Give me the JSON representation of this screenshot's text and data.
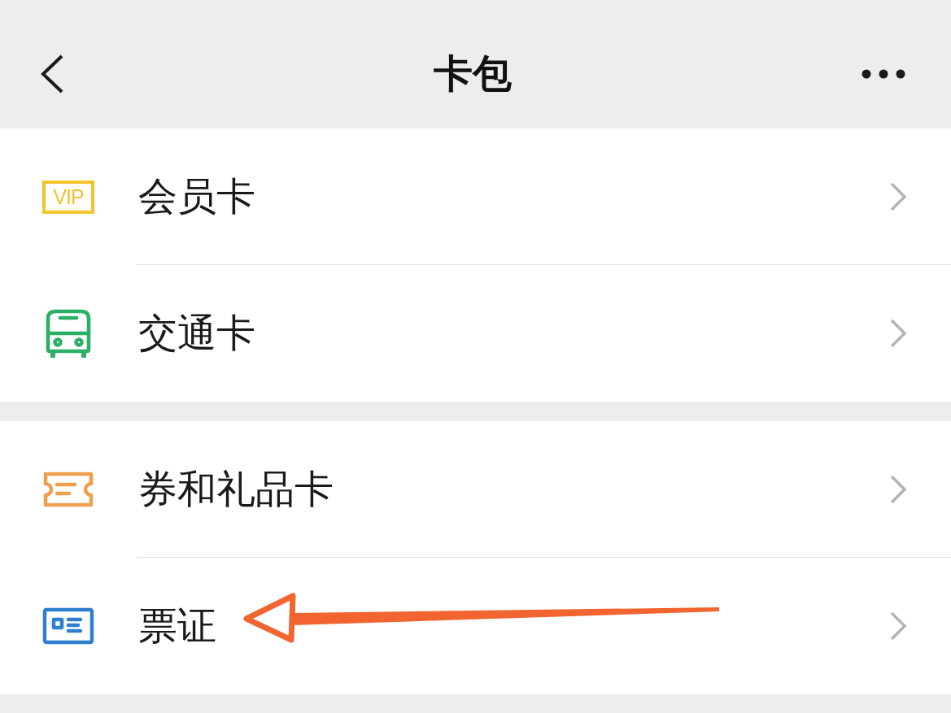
{
  "header": {
    "title": "卡包"
  },
  "groups": [
    {
      "items": [
        {
          "kind": "vip",
          "badge": "VIP",
          "label": "会员卡",
          "annotated": false
        },
        {
          "kind": "bus",
          "label": "交通卡",
          "annotated": false
        }
      ]
    },
    {
      "items": [
        {
          "kind": "ticket",
          "label": "券和礼品卡",
          "annotated": false
        },
        {
          "kind": "id-card",
          "label": "票证",
          "annotated": true
        }
      ]
    }
  ]
}
